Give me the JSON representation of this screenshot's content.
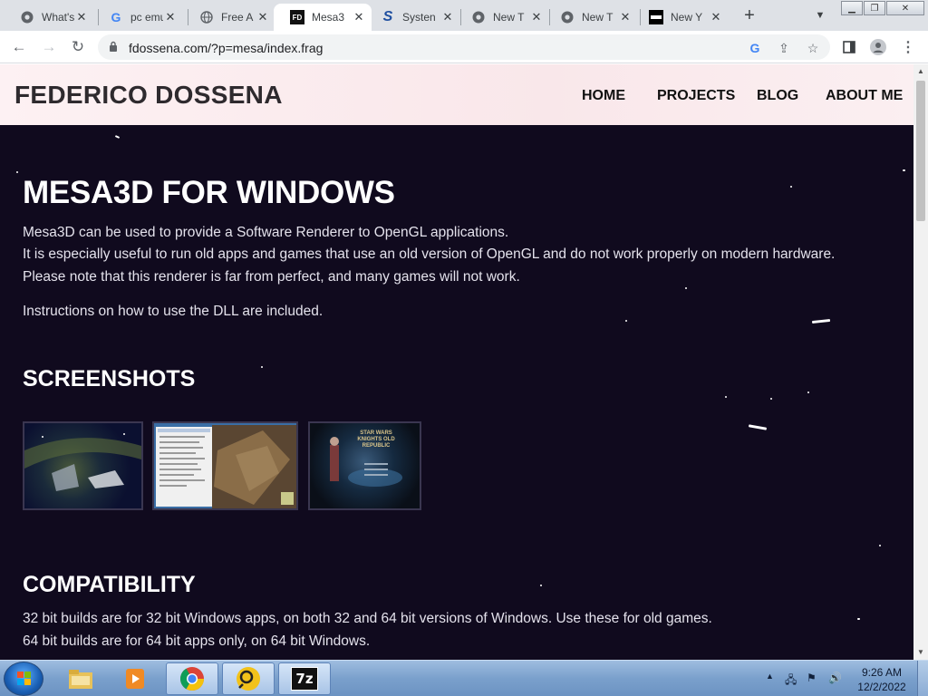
{
  "browser": {
    "tabs": [
      {
        "title": "What's",
        "icon": "chrome-icon",
        "active": false
      },
      {
        "title": "pc emu",
        "icon": "google-icon",
        "active": false
      },
      {
        "title": "Free A",
        "icon": "globe-icon",
        "active": false
      },
      {
        "title": "Mesa3",
        "icon": "fd-icon",
        "active": true
      },
      {
        "title": "Systen",
        "icon": "s-logo-icon",
        "active": false
      },
      {
        "title": "New T",
        "icon": "chrome-icon",
        "active": false
      },
      {
        "title": "New T",
        "icon": "chrome-icon",
        "active": false
      },
      {
        "title": "New Y",
        "icon": "clock-favicon-icon",
        "active": false
      }
    ],
    "url": "fdossena.com/?p=mesa/index.frag"
  },
  "site": {
    "logo": "FEDERICO DOSSENA",
    "nav": [
      "HOME",
      "PROJECTS",
      "BLOG",
      "ABOUT ME"
    ]
  },
  "page": {
    "title": "MESA3D FOR WINDOWS",
    "intro": [
      "Mesa3D can be used to provide a Software Renderer to OpenGL applications.",
      "It is especially useful to run old apps and games that use an old version of OpenGL and do not work properly on modern hardware.",
      "Please note that this renderer is far from perfect, and many games will not work."
    ],
    "instructions": "Instructions on how to use the DLL are included.",
    "screenshots_heading": "SCREENSHOTS",
    "screenshot3_text": "STAR WARS KNIGHTS OLD REPUBLIC",
    "compat_heading": "COMPATIBILITY",
    "compat": [
      "32 bit builds are for 32 bit Windows apps, on both 32 and 64 bit versions of Windows. Use these for old games.",
      "64 bit builds are for 64 bit apps only, on 64 bit Windows."
    ]
  },
  "taskbar": {
    "apps": [
      "explorer-icon",
      "media-player-icon",
      "chrome-icon",
      "teamviewer-icon",
      "7zip-icon"
    ],
    "app_7zip_label": "7z",
    "time": "9:26 AM",
    "date": "12/2/2022"
  },
  "colors": {
    "page_bg": "#100a1e",
    "header_bg": "#f9e7ea",
    "taskbar": "#7aa0cc"
  }
}
